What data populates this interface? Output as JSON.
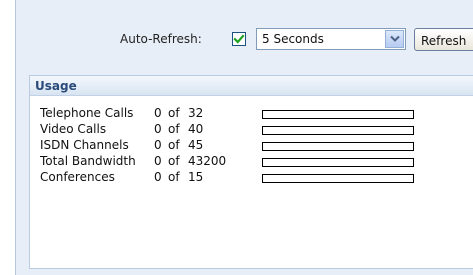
{
  "toolbar": {
    "auto_refresh_label": "Auto-Refresh:",
    "auto_refresh_checked": true,
    "interval_selected": "5 Seconds",
    "refresh_button_label": "Refresh"
  },
  "usage": {
    "title": "Usage",
    "of_text": "of",
    "rows": [
      {
        "label": "Telephone Calls",
        "count": "0",
        "max": "32",
        "fill_fraction": 0
      },
      {
        "label": "Video Calls",
        "count": "0",
        "max": "40",
        "fill_fraction": 0
      },
      {
        "label": "ISDN Channels",
        "count": "0",
        "max": "45",
        "fill_fraction": 0
      },
      {
        "label": "Total Bandwidth",
        "count": "0",
        "max": "43200",
        "fill_fraction": 0
      },
      {
        "label": "Conferences",
        "count": "0",
        "max": "15",
        "fill_fraction": 0
      }
    ]
  },
  "colors": {
    "panel_background": "#e8eef7",
    "header_text": "#2a4a7a",
    "checkmark": "#21a121"
  },
  "icons": {
    "checkbox": "checkmark-icon",
    "dropdown": "chevron-down-icon"
  }
}
